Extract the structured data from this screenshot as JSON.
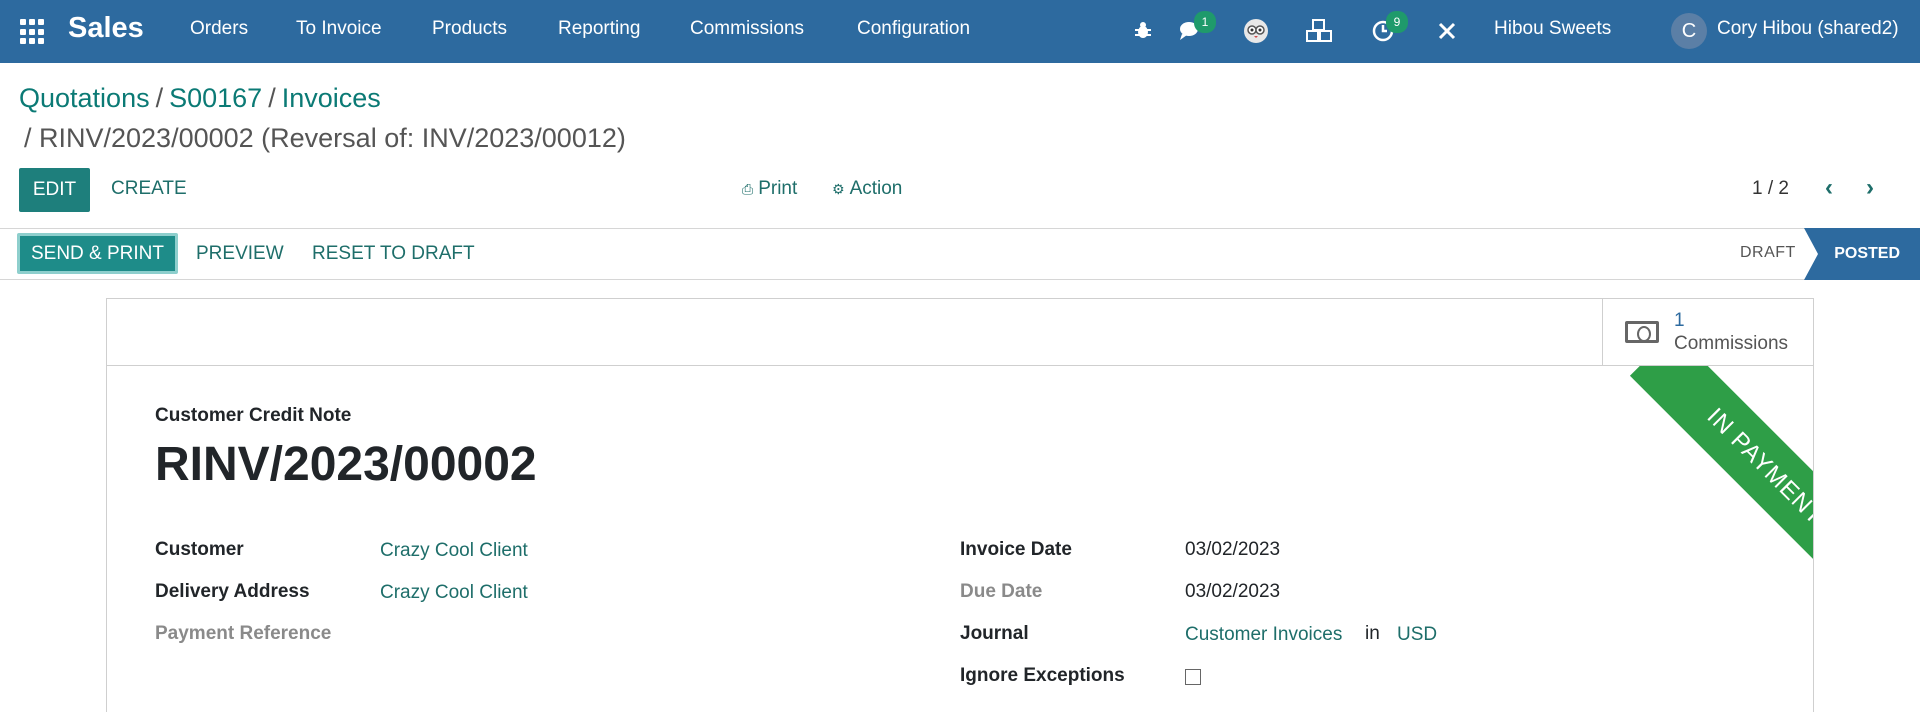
{
  "topbar": {
    "app_name": "Sales",
    "menu": [
      "Orders",
      "To Invoice",
      "Products",
      "Reporting",
      "Commissions",
      "Configuration"
    ],
    "messages_badge": "1",
    "activities_badge": "9",
    "company": "Hibou Sweets",
    "avatar_initial": "C",
    "user": "Cory Hibou (shared2)"
  },
  "breadcrumb": {
    "items": [
      "Quotations",
      "S00167",
      "Invoices"
    ],
    "current": "/ RINV/2023/00002 (Reversal of: INV/2023/00012)"
  },
  "control_panel": {
    "edit": "EDIT",
    "create": "CREATE",
    "print": "Print",
    "action": "Action",
    "pager": "1 / 2"
  },
  "statusbar": {
    "send_print": "SEND & PRINT",
    "preview": "PREVIEW",
    "reset": "RESET TO DRAFT",
    "stages": [
      "DRAFT",
      "POSTED"
    ],
    "active_stage": "POSTED"
  },
  "sheet": {
    "stat_value": "1",
    "stat_label": "Commissions",
    "ribbon": "IN PAYMENT",
    "doc_type": "Customer Credit Note",
    "doc_name": "RINV/2023/00002",
    "left_fields": [
      {
        "label": "Customer",
        "value": "Crazy Cool Client"
      },
      {
        "label": "Delivery Address",
        "value": "Crazy Cool Client"
      },
      {
        "label": "Payment Reference",
        "value": ""
      }
    ],
    "right_fields": {
      "invoice_date_label": "Invoice Date",
      "invoice_date": "03/02/2023",
      "due_date_label": "Due Date",
      "due_date": "03/02/2023",
      "journal_label": "Journal",
      "journal": "Customer Invoices",
      "journal_in": "in",
      "currency": "USD",
      "ignore_label": "Ignore Exceptions"
    }
  },
  "colors": {
    "nav": "#2d6a9f",
    "primary": "#1e7f7c",
    "ribbon": "#2e9e47"
  }
}
